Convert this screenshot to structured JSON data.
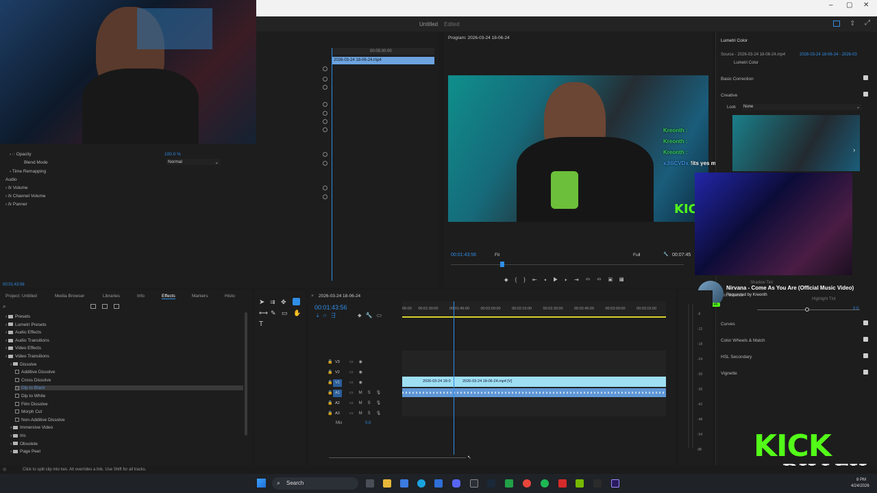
{
  "window": {
    "title": "Untitled",
    "status": "Edited"
  },
  "effect_controls": {
    "timecode_top": "00:05:00:00",
    "clip_name": "2026-03-24 18-06-24.mp4",
    "opacity_label": "Opacity",
    "opacity_value": "100.0 %",
    "blend_mode_label": "Blend Mode",
    "blend_mode_value": "Normal",
    "time_remapping": "Time Remapping",
    "audio_header": "Audio",
    "volume": "Volume",
    "channel_volume": "Channel Volume",
    "panner": "Panner",
    "current_time": "00:01:43:56"
  },
  "program": {
    "title": "Program: 2026-03-24 18-06-24",
    "timecode": "00:01:43:56",
    "fit": "Fit",
    "quality": "Full",
    "duration": "00:07:45"
  },
  "chat": {
    "lines": [
      {
        "user": "Kreonth :",
        "color": "#33cc55"
      },
      {
        "user": "Kreonth :",
        "color": "#33cc55"
      },
      {
        "user": "Kreonth :",
        "color": "#33cc55"
      },
      {
        "user": "xJiliCVDx",
        "message": "!its yes my guy",
        "color": "#3a8dde"
      }
    ]
  },
  "lumetri": {
    "title": "Lumetri Color",
    "source": "Source - 2026-03-24 18-06-24.mp4",
    "source_clip": "2026-03-24 18-06-24 - 2026-03",
    "preset": "Lumetri Color",
    "sections": [
      "Basic Correction",
      "Creative",
      "Curves",
      "Color Wheels & Match",
      "HSL Secondary",
      "Vignette"
    ],
    "look_label": "Look",
    "look_value": "None",
    "tint_balance": "Tint Balance",
    "tint_value": "0.0",
    "highlight_tint": "Highlight Tint",
    "shadow_tint": "Shadow Tint"
  },
  "now_playing": {
    "title": "Nirvana - Come As You Are (Official Music Video)",
    "requested": "Requested by Kreonth",
    "time": "00:46"
  },
  "project": {
    "tabs": [
      "Project: Untitled",
      "Media Browser",
      "Libraries",
      "Info",
      "Effects",
      "Markers",
      "Histo"
    ],
    "active_tab": "Effects",
    "tree": [
      {
        "label": "Presets",
        "type": "folder",
        "indent": 0
      },
      {
        "label": "Lumetri Presets",
        "type": "folder",
        "indent": 0
      },
      {
        "label": "Audio Effects",
        "type": "folder",
        "indent": 0
      },
      {
        "label": "Audio Transitions",
        "type": "folder",
        "indent": 0
      },
      {
        "label": "Video Effects",
        "type": "folder",
        "indent": 0
      },
      {
        "label": "Video Transitions",
        "type": "folder",
        "indent": 0
      },
      {
        "label": "Dissolve",
        "type": "folder",
        "indent": 1
      },
      {
        "label": "Additive Dissolve",
        "type": "fx",
        "indent": 2
      },
      {
        "label": "Cross Dissolve",
        "type": "fx",
        "indent": 2
      },
      {
        "label": "Dip to Black",
        "type": "fx",
        "indent": 2,
        "selected": true
      },
      {
        "label": "Dip to White",
        "type": "fx",
        "indent": 2
      },
      {
        "label": "Film Dissolve",
        "type": "fx",
        "indent": 2
      },
      {
        "label": "Morph Cut",
        "type": "fx",
        "indent": 2
      },
      {
        "label": "Non-Additive Dissolve",
        "type": "fx",
        "indent": 2
      },
      {
        "label": "Immersive Video",
        "type": "folder",
        "indent": 1
      },
      {
        "label": "Iris",
        "type": "folder",
        "indent": 1
      },
      {
        "label": "Obsolete",
        "type": "folder",
        "indent": 1
      },
      {
        "label": "Page Peel",
        "type": "folder",
        "indent": 1
      }
    ]
  },
  "timeline": {
    "sequence": "2026-03-24 18-06-24",
    "timecode": "00:01:43:56",
    "ruler": [
      "00:00",
      "00:01:30:00",
      "00:01:45:00",
      "00:02:00:00",
      "00:02:15:00",
      "00:02:30:00",
      "00:02:45:00",
      "00:03:00:00",
      "00:03:15:00"
    ],
    "video_tracks": [
      "V3",
      "V2",
      "V1"
    ],
    "audio_tracks": [
      "A1",
      "A2",
      "A3"
    ],
    "mix_label": "Mix",
    "mix_value": "0.0",
    "clip_a": "2026-03-24 18-0",
    "clip_b": "2026-03-24 18-06-24.mp4 [V]"
  },
  "meters": {
    "scale": [
      "-6",
      "-12",
      "-18",
      "-24",
      "-30",
      "-36",
      "-42",
      "-48",
      "-54",
      "dB"
    ],
    "solo": "S"
  },
  "status_bar": "Click to split clip into two. Alt overrides a link. Use Shift for all tracks.",
  "taskbar": {
    "search": "Search",
    "time": "8 PM",
    "date": "4/24/2026"
  },
  "kick": {
    "brand": "KICK",
    "name": "BILLEH"
  }
}
